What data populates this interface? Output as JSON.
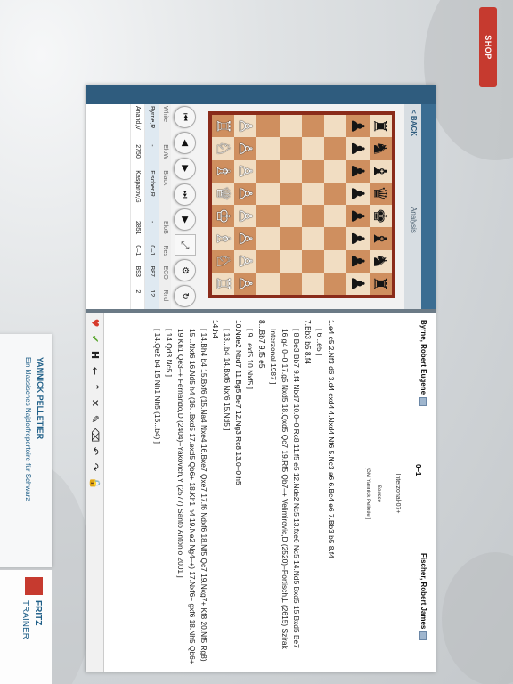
{
  "shop_button": "SHOP",
  "brand": {
    "name": "FRITZ",
    "product": "TRAINER"
  },
  "course": {
    "author": "YANNICK PELLETIER",
    "title": "Ein klassisches Najdorfrepertoire für Schwarz"
  },
  "nav": {
    "back_label": "< BACK",
    "analysis_tab": "Analysis"
  },
  "game_list": {
    "columns": [
      "White",
      "EloW",
      "Black",
      "EloB",
      "Res",
      "ECO",
      "Rnd"
    ],
    "rows": [
      [
        "Byrne,R",
        "-",
        "Fischer,R",
        "-",
        "0–1",
        "B87",
        "12"
      ],
      [
        "Anand,V",
        "2750",
        "Kasparov,G",
        "2851",
        "0–1",
        "B93",
        "2"
      ]
    ]
  },
  "game_header": {
    "white": "Byrne, Robert Eugene",
    "result": "0–1",
    "black": "Fischer, Robert James",
    "event": "Interzonal-07+",
    "location": "Sousse",
    "annotator": "[GM Yannick Pelletier]"
  },
  "notation": [
    {
      "type": "main",
      "text": "1.e4 c5 2.Nf3 d6 3.d4 cxd4 4.Nxd4 Nf6 5.Nc3 a6 6.Bc4 e6 7.Bb3 b5 8.f4"
    },
    {
      "type": "bracket",
      "text": "[ 6...e5 ]"
    },
    {
      "type": "main",
      "text": "7.Bb3 b5 8.f4"
    },
    {
      "type": "bracket",
      "text": "[ 8.Be3 Bb7 9.f4 Nbd7 10.0–0 Rc8 11.f5 e5 12.Nde2 Nc5 13.fxe6 Nc5 14.Nd5 Bxd5 15.Bxd5 Be7 16.g4 0–0 17.g5 Nxd5 18.Qxd5 Qc7 19.Rf5 Qb7–+ Velimirovic,D (2520)–Portisch,L (2615) Szirak Interzonal 1987 ]"
    },
    {
      "type": "main",
      "text": "8...Bb7 9.f5 e5"
    },
    {
      "type": "bracket",
      "text": "[ 9...exf5 10.Nxf5 ]"
    },
    {
      "type": "main",
      "text": "10.Nde2 Nbd7 11.Bg5 Be7 12.Ng3 Rc8 13.0–0 h5"
    },
    {
      "type": "bracket",
      "text": "[ 13...b4 14.Bxf6 Nxf6 15.Nd5 ]"
    },
    {
      "type": "main",
      "text": "14.h4"
    },
    {
      "type": "bracket",
      "text": "[ 14.Bh4 b4 15.Bxf6 (15.Na4 Nxe4 16.Bxe7 Qxe7 17.f6 Ndxf6 18.Nf5 Qc7 19.Nxg7+ Kf8 20.Nf5 Rg8) 15...Nxf6 16.Nd5 h4 (16...Bxd5 17.exd5 Qb6+ 18.Kh1 h4 19.Ne2 Ng4–+) 17.Nxf6+ gxf6 18.Nh5 Qb6+ 19.Kh1 Qe3–+ Fernando,D (2404)–Yakovich,Y (2577) Santo Antonio 2001 ]"
    },
    {
      "type": "bracket",
      "text": "[ 14.Qd3 Nc5 ]"
    },
    {
      "type": "bracket",
      "text": "[ 14.Qe2 b4 15.Nh1 Nh5 (15...b4) ]"
    }
  ],
  "board": {
    "rows": [
      [
        "r",
        "n",
        "b",
        "q",
        "k",
        "b",
        "n",
        "r"
      ],
      [
        "p",
        "p",
        "p",
        "p",
        "p",
        "p",
        "p",
        "p"
      ],
      [
        "",
        "",
        "",
        "",
        "",
        "",
        "",
        ""
      ],
      [
        "",
        "",
        "",
        "",
        "",
        "",
        "",
        ""
      ],
      [
        "",
        "",
        "",
        "",
        "",
        "",
        "",
        ""
      ],
      [
        "",
        "",
        "",
        "",
        "",
        "",
        "",
        ""
      ],
      [
        "P",
        "P",
        "P",
        "P",
        "P",
        "P",
        "P",
        "P"
      ],
      [
        "R",
        "N",
        "B",
        "Q",
        "K",
        "B",
        "N",
        "R"
      ]
    ]
  },
  "toolbar_icons": [
    "first-icon",
    "back-icon",
    "forward-icon",
    "last-icon",
    "play-icon",
    "reset-icon",
    "flip-icon",
    "fullscreen-icon",
    "wheel-icon",
    "refresh-icon"
  ]
}
